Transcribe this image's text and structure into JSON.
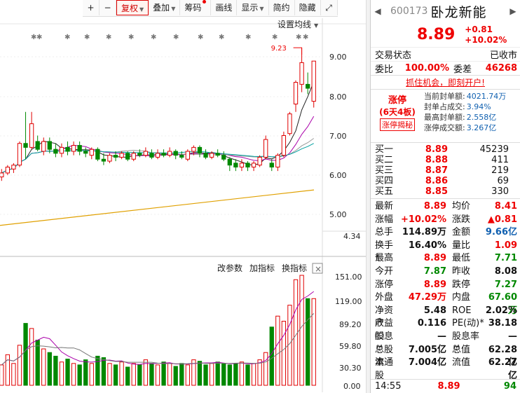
{
  "toolbar": {
    "plus": "+",
    "minus": "−",
    "fuquan": "复权",
    "diejia": "叠加",
    "chouma": "筹码",
    "huaxian": "画线",
    "xianshi": "显示",
    "jianyue": "简约",
    "yincang": "隐藏",
    "expand": "⤢"
  },
  "chart": {
    "set_ma_label": "设置均线",
    "y_ticks": [
      "9.00",
      "8.00",
      "7.00",
      "6.00",
      "5.00"
    ],
    "current_low": "4.34",
    "high_mark": "9.23",
    "vol_ticks": [
      "151.00",
      "119.00",
      "89.20",
      "59.80",
      "30.30",
      "0.00"
    ],
    "gaicanshu": "改参数",
    "jiazhibiao": "加指标",
    "huanzhibiao": "换指标",
    "close_btn": "×"
  },
  "stock": {
    "code": "600173",
    "name": "卧龙新能",
    "price": "8.89",
    "change": "+0.81",
    "change_pct": "+10.02%"
  },
  "status": {
    "label": "交易状态",
    "value": "已收市"
  },
  "weibi": {
    "label": "委比",
    "value": "100.00%",
    "label2": "委差",
    "value2": "46268"
  },
  "promo": "抓住机会，即刻开户!",
  "zhangting": {
    "title": "涨停",
    "sub": "(6天4板)",
    "btn": "涨停揭秘",
    "rows": [
      {
        "label": "当前封单额:",
        "value": "4021.74万"
      },
      {
        "label": "封单占成交:",
        "value": "3.94%"
      },
      {
        "label": "最高封单额:",
        "value": "2.558亿"
      },
      {
        "label": "涨停成交额:",
        "value": "3.267亿"
      }
    ]
  },
  "buy": [
    {
      "label": "买一",
      "price": "8.89",
      "qty": "45239"
    },
    {
      "label": "买二",
      "price": "8.88",
      "qty": "411"
    },
    {
      "label": "买三",
      "price": "8.87",
      "qty": "219"
    },
    {
      "label": "买四",
      "price": "8.86",
      "qty": "69"
    },
    {
      "label": "买五",
      "price": "8.85",
      "qty": "330"
    }
  ],
  "quote": [
    {
      "k1": "最新",
      "v1": "8.89",
      "c1": "red",
      "k2": "均价",
      "v2": "8.41",
      "c2": "red"
    },
    {
      "k1": "涨幅",
      "v1": "+10.02%",
      "c1": "red",
      "k2": "涨跌",
      "v2": "▲0.81",
      "c2": "red"
    },
    {
      "k1": "总手",
      "v1": "114.89万",
      "c1": "",
      "k2": "金额",
      "v2": "9.66亿",
      "c2": "blue"
    },
    {
      "k1": "换手*",
      "v1": "16.40%",
      "c1": "",
      "k2": "量比",
      "v2": "1.09",
      "c2": "red"
    },
    {
      "k1": "最高",
      "v1": "8.89",
      "c1": "red",
      "k2": "最低",
      "v2": "7.71",
      "c2": "green"
    },
    {
      "k1": "今开",
      "v1": "7.87",
      "c1": "green",
      "k2": "昨收",
      "v2": "8.08",
      "c2": ""
    },
    {
      "k1": "涨停",
      "v1": "8.89",
      "c1": "red",
      "k2": "跌停",
      "v2": "7.27",
      "c2": "green"
    },
    {
      "k1": "外盘",
      "v1": "47.29万",
      "c1": "red",
      "k2": "内盘",
      "v2": "67.60万",
      "c2": "green"
    },
    {
      "k1": "净资产",
      "v1": "5.48",
      "c1": "",
      "k2": "ROE",
      "v2": "2.02%",
      "c2": ""
    },
    {
      "k1": "收益㈢",
      "v1": "0.116",
      "c1": "",
      "k2": "PE(动)*",
      "v2": "38.18",
      "c2": ""
    },
    {
      "k1": "股息™",
      "v1": "—",
      "c1": "",
      "k2": "股息率™",
      "v2": "—",
      "c2": ""
    },
    {
      "k1": "总股本",
      "v1": "7.005亿",
      "c1": "",
      "k2": "总值",
      "v2": "62.28亿",
      "c2": ""
    },
    {
      "k1": "流通股",
      "v1": "7.004亿",
      "c1": "",
      "k2": "流值",
      "v2": "62.27亿",
      "c2": ""
    }
  ],
  "footer": {
    "time": "14:55",
    "price": "8.89",
    "vol": "94"
  },
  "colors": {
    "up": "#e00000",
    "down": "#008800",
    "blue": "#1060b0",
    "ma5": "#222222",
    "ma10": "#aa00aa",
    "ma20": "#9a9a9a",
    "ma60": "#00a0a0",
    "ma250": "#e0a000"
  },
  "chart_data": [
    {
      "type": "candlestick",
      "y_axis_labels": [
        "9.00",
        "8.00",
        "7.00",
        "6.00",
        "5.00"
      ],
      "ylim": [
        4.34,
        9.23
      ],
      "candles": [
        {
          "o": 5.95,
          "c": 6.05,
          "h": 6.15,
          "l": 5.85
        },
        {
          "o": 6.05,
          "c": 6.2,
          "h": 6.25,
          "l": 6.0
        },
        {
          "o": 6.15,
          "c": 6.25,
          "h": 6.3,
          "l": 6.05
        },
        {
          "o": 6.25,
          "c": 6.8,
          "h": 6.85,
          "l": 6.2
        },
        {
          "o": 6.8,
          "c": 6.7,
          "h": 7.6,
          "l": 6.4
        },
        {
          "o": 6.7,
          "c": 7.3,
          "h": 7.6,
          "l": 6.65
        },
        {
          "o": 6.85,
          "c": 6.65,
          "h": 7.0,
          "l": 6.6
        },
        {
          "o": 6.6,
          "c": 6.85,
          "h": 6.95,
          "l": 6.5
        },
        {
          "o": 6.85,
          "c": 6.65,
          "h": 6.95,
          "l": 6.55
        },
        {
          "o": 6.65,
          "c": 6.55,
          "h": 6.8,
          "l": 6.45
        },
        {
          "o": 6.55,
          "c": 6.7,
          "h": 6.8,
          "l": 6.45
        },
        {
          "o": 6.7,
          "c": 6.6,
          "h": 6.85,
          "l": 6.5
        },
        {
          "o": 6.6,
          "c": 6.75,
          "h": 6.85,
          "l": 6.5
        },
        {
          "o": 6.75,
          "c": 6.6,
          "h": 6.85,
          "l": 6.5
        },
        {
          "o": 6.6,
          "c": 6.55,
          "h": 6.7,
          "l": 6.45
        },
        {
          "o": 6.5,
          "c": 6.65,
          "h": 6.7,
          "l": 6.4
        },
        {
          "o": 6.65,
          "c": 6.4,
          "h": 6.7,
          "l": 6.35
        },
        {
          "o": 6.4,
          "c": 6.35,
          "h": 6.55,
          "l": 6.25
        },
        {
          "o": 6.35,
          "c": 6.5,
          "h": 6.55,
          "l": 6.3
        },
        {
          "o": 6.5,
          "c": 6.45,
          "h": 6.6,
          "l": 6.35
        },
        {
          "o": 6.45,
          "c": 6.55,
          "h": 6.6,
          "l": 6.4
        },
        {
          "o": 6.55,
          "c": 6.4,
          "h": 6.6,
          "l": 6.35
        },
        {
          "o": 6.4,
          "c": 6.55,
          "h": 6.6,
          "l": 6.35
        },
        {
          "o": 6.55,
          "c": 6.5,
          "h": 6.65,
          "l": 6.45
        },
        {
          "o": 6.5,
          "c": 6.6,
          "h": 6.7,
          "l": 6.45
        },
        {
          "o": 6.55,
          "c": 6.45,
          "h": 6.65,
          "l": 6.4
        },
        {
          "o": 6.45,
          "c": 6.55,
          "h": 6.65,
          "l": 6.4
        },
        {
          "o": 6.55,
          "c": 6.5,
          "h": 6.65,
          "l": 6.45
        },
        {
          "o": 6.5,
          "c": 6.6,
          "h": 6.7,
          "l": 6.45
        },
        {
          "o": 6.6,
          "c": 6.5,
          "h": 6.65,
          "l": 6.4
        },
        {
          "o": 6.5,
          "c": 6.45,
          "h": 6.6,
          "l": 6.4
        },
        {
          "o": 6.4,
          "c": 6.6,
          "h": 6.65,
          "l": 6.35
        },
        {
          "o": 6.6,
          "c": 6.7,
          "h": 6.75,
          "l": 6.5
        },
        {
          "o": 6.7,
          "c": 6.55,
          "h": 6.75,
          "l": 6.45
        },
        {
          "o": 6.55,
          "c": 6.45,
          "h": 6.65,
          "l": 6.4
        },
        {
          "o": 6.45,
          "c": 6.55,
          "h": 6.6,
          "l": 6.4
        },
        {
          "o": 6.55,
          "c": 6.5,
          "h": 6.65,
          "l": 6.45
        },
        {
          "o": 6.5,
          "c": 6.4,
          "h": 6.6,
          "l": 6.35
        },
        {
          "o": 6.4,
          "c": 6.25,
          "h": 6.45,
          "l": 6.1
        },
        {
          "o": 6.3,
          "c": 6.2,
          "h": 6.4,
          "l": 6.1
        },
        {
          "o": 6.2,
          "c": 6.3,
          "h": 6.4,
          "l": 6.1
        },
        {
          "o": 6.3,
          "c": 6.2,
          "h": 6.35,
          "l": 6.1
        },
        {
          "o": 6.2,
          "c": 6.3,
          "h": 6.35,
          "l": 6.1
        },
        {
          "o": 6.25,
          "c": 6.45,
          "h": 6.5,
          "l": 6.2
        },
        {
          "o": 6.45,
          "c": 6.9,
          "h": 7.0,
          "l": 6.4
        },
        {
          "o": 6.3,
          "c": 6.2,
          "h": 6.4,
          "l": 6.1
        },
        {
          "o": 6.2,
          "c": 6.5,
          "h": 6.55,
          "l": 6.1
        },
        {
          "o": 6.5,
          "c": 7.0,
          "h": 7.1,
          "l": 6.45
        },
        {
          "o": 7.05,
          "c": 7.55,
          "h": 7.6,
          "l": 7.0
        },
        {
          "o": 7.8,
          "c": 8.35,
          "h": 8.4,
          "l": 7.6
        },
        {
          "o": 8.3,
          "c": 8.85,
          "h": 9.23,
          "l": 8.1
        },
        {
          "o": 8.3,
          "c": 8.2,
          "h": 8.6,
          "l": 8.05
        },
        {
          "o": 7.87,
          "c": 8.89,
          "h": 8.89,
          "l": 7.71
        }
      ]
    },
    {
      "type": "bar",
      "y_axis_labels": [
        "151.00",
        "119.00",
        "89.20",
        "59.80",
        "30.30",
        "0.00"
      ],
      "ylim": [
        0,
        151
      ],
      "values": [
        28,
        42,
        30,
        55,
        85,
        78,
        62,
        50,
        45,
        40,
        32,
        36,
        30,
        28,
        35,
        30,
        40,
        38,
        30,
        28,
        32,
        25,
        30,
        28,
        35,
        30,
        28,
        32,
        30,
        26,
        30,
        28,
        35,
        33,
        28,
        30,
        32,
        30,
        28,
        30,
        32,
        28,
        30,
        35,
        45,
        80,
        95,
        88,
        110,
        145,
        151,
        119,
        119
      ]
    }
  ]
}
